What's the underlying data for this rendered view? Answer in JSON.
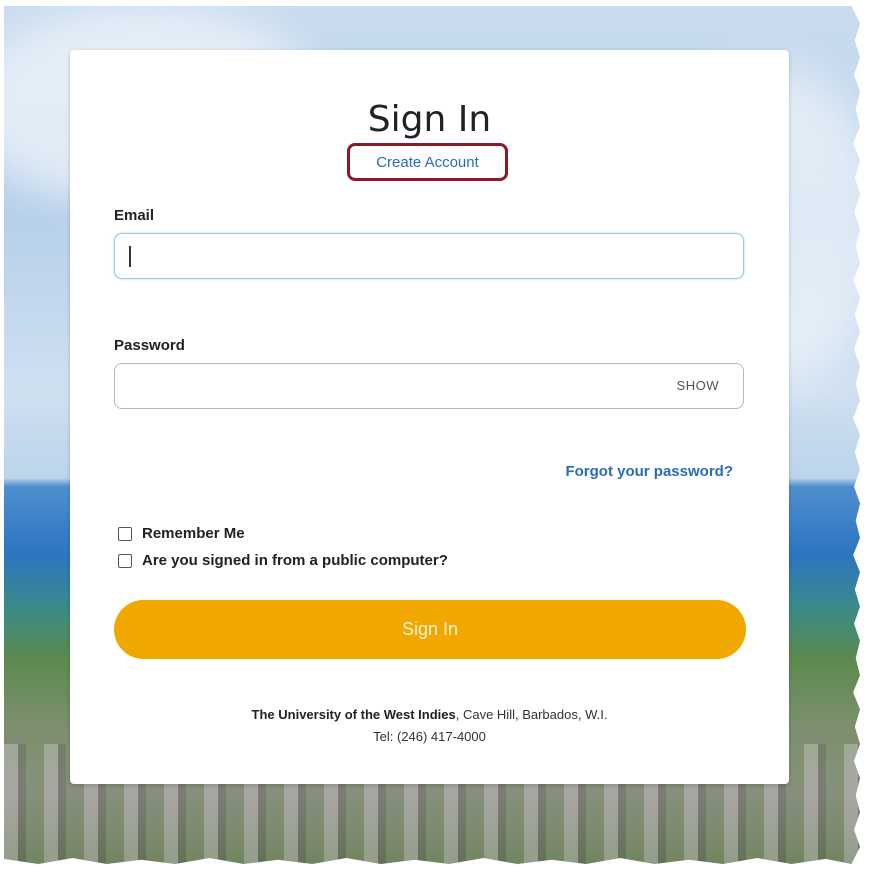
{
  "title": "Sign In",
  "create_account": "Create Account",
  "email": {
    "label": "Email",
    "value": "",
    "placeholder": ""
  },
  "password": {
    "label": "Password",
    "value": "",
    "show_label": "SHOW"
  },
  "forgot_password": "Forgot your password?",
  "remember_me": {
    "label": "Remember Me",
    "checked": false
  },
  "public_computer": {
    "label": "Are you signed in from a public computer?",
    "checked": false
  },
  "sign_in_button": "Sign In",
  "footer": {
    "institution": "The University of the West Indies",
    "location": ", Cave Hill, Barbados, W.I.",
    "tel": "Tel: (246) 417-4000"
  },
  "colors": {
    "button": "#f0a800",
    "link": "#2a6db5",
    "highlight_border": "#8b1a28"
  }
}
